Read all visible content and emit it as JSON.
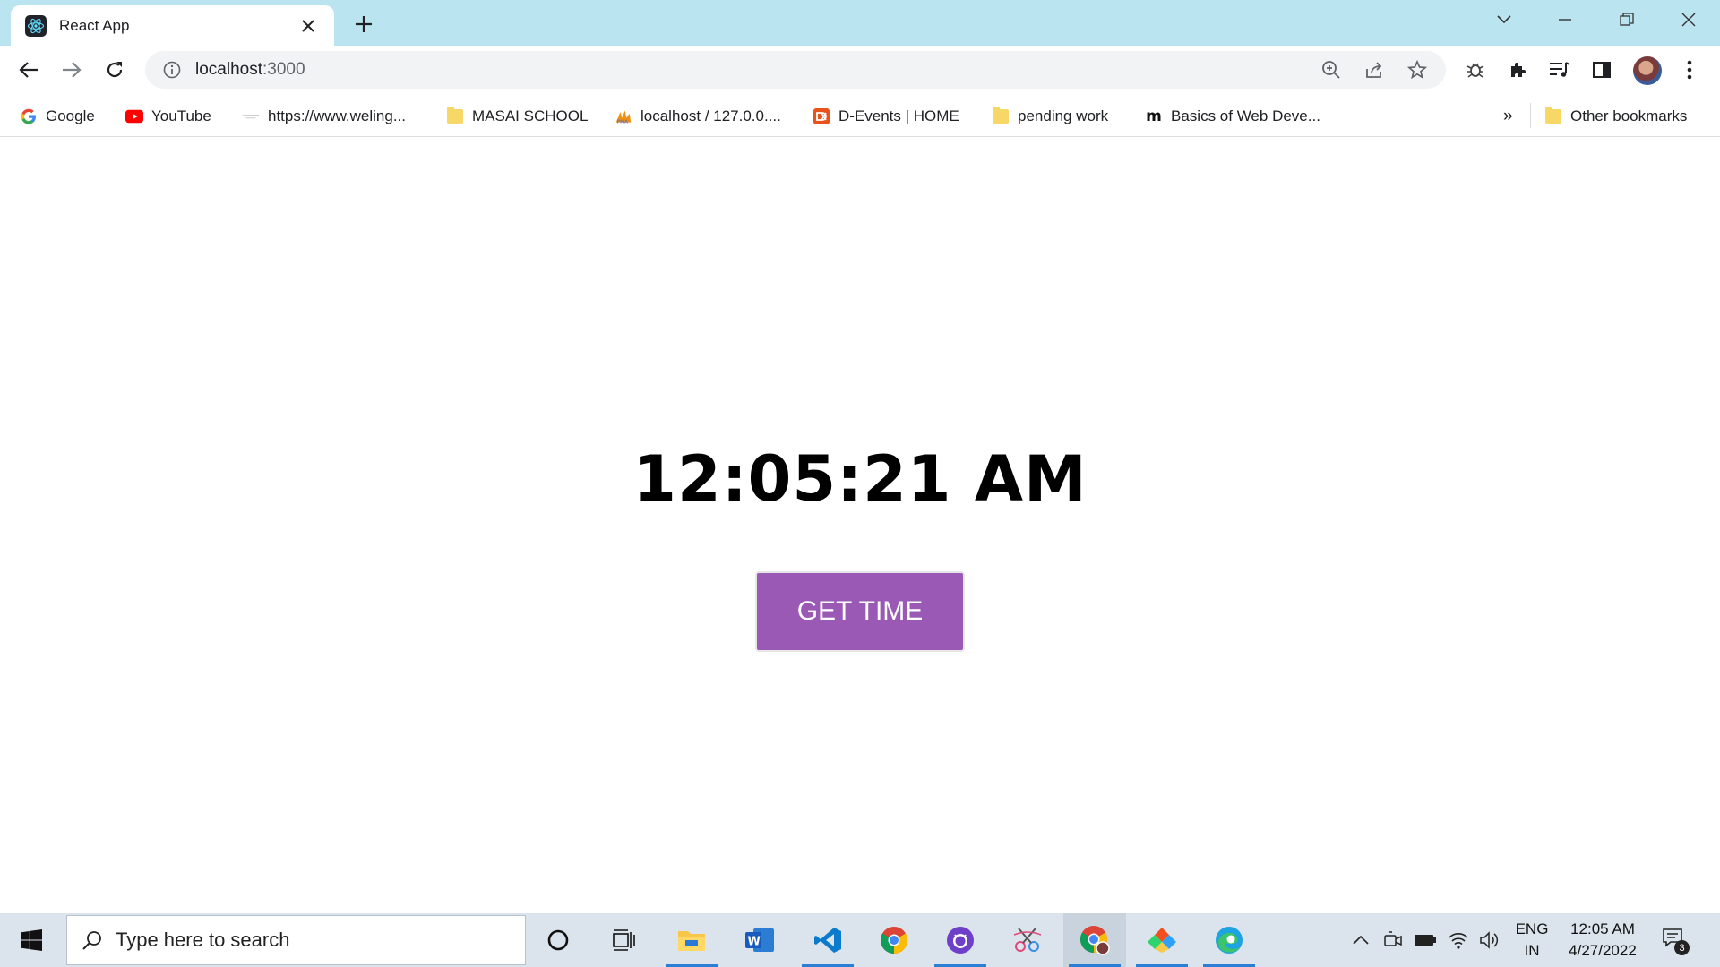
{
  "browser": {
    "tab": {
      "title": "React App",
      "favicon": "react-icon"
    },
    "address": {
      "host": "localhost",
      "port": ":3000"
    },
    "bookmarks": [
      {
        "label": "Google",
        "icon": "google-icon"
      },
      {
        "label": "YouTube",
        "icon": "youtube-icon"
      },
      {
        "label": "https://www.weling...",
        "icon": "site-icon"
      },
      {
        "label": "MASAI SCHOOL",
        "icon": "folder-icon"
      },
      {
        "label": "localhost / 127.0.0....",
        "icon": "phpmyadmin-icon"
      },
      {
        "label": "D-Events | HOME",
        "icon": "site-icon"
      },
      {
        "label": "pending work",
        "icon": "folder-icon"
      },
      {
        "label": "Basics of Web Deve...",
        "icon": "medium-icon"
      }
    ],
    "bookmarks_overflow": "»",
    "other_bookmarks": "Other bookmarks"
  },
  "app": {
    "time": "12:05:21 AM",
    "button_label": "GET TIME",
    "button_color": "#9b59b6"
  },
  "taskbar": {
    "search_placeholder": "Type here to search",
    "language_top": "ENG",
    "language_bottom": "IN",
    "clock_time": "12:05 AM",
    "clock_date": "4/27/2022",
    "notification_count": "3"
  }
}
